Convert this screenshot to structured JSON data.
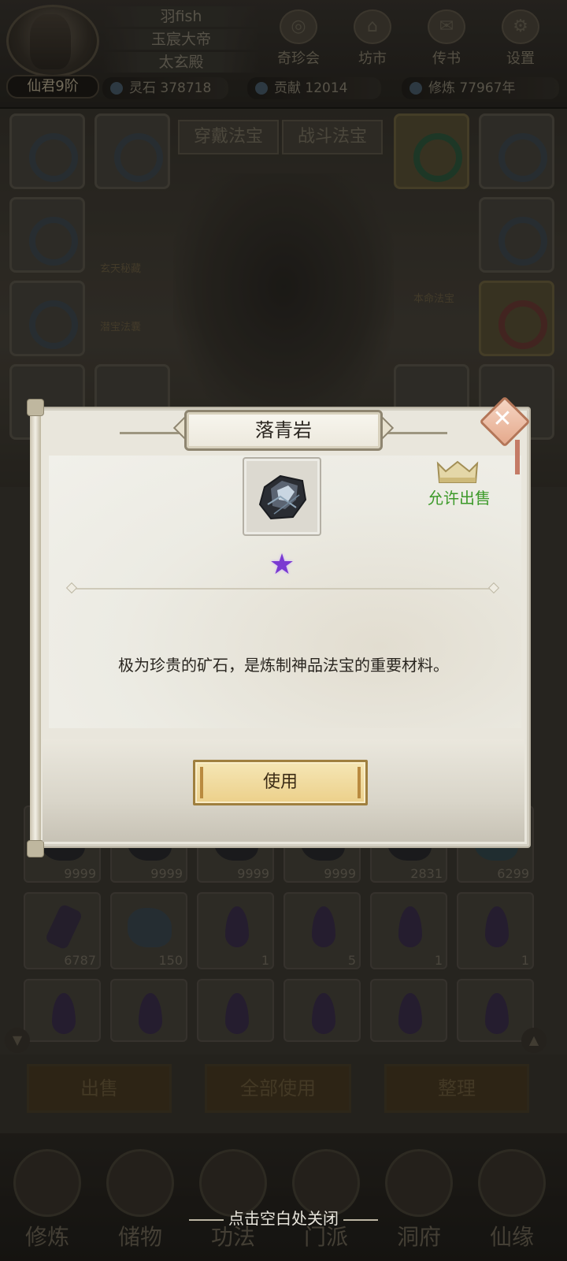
{
  "player": {
    "name": "羽fish",
    "title": "玉宸大帝",
    "sect": "太玄殿",
    "rank": "仙君9阶"
  },
  "resources": [
    {
      "label": "灵石 378718"
    },
    {
      "label": "贡献 12014"
    },
    {
      "label": "修炼 77967年"
    }
  ],
  "top_menu": [
    {
      "label": "奇珍会",
      "icon": "treasure-icon"
    },
    {
      "label": "坊市",
      "icon": "market-icon"
    },
    {
      "label": "传书",
      "icon": "letter-icon"
    },
    {
      "label": "设置",
      "icon": "gear-icon"
    }
  ],
  "equip_tabs": [
    "穿戴法宝",
    "战斗法宝"
  ],
  "equip_side_labels": [
    "玄天秘藏",
    "潜宝法囊",
    "本命法宝"
  ],
  "inventory_counts": {
    "row_a": [
      "9999",
      "9999",
      "9999",
      "9999",
      "2831",
      "6299"
    ],
    "row_b": [
      "6787",
      "150",
      "1",
      "5",
      "1",
      "1"
    ]
  },
  "bottom_buttons": [
    "出售",
    "全部使用",
    "整理"
  ],
  "nav": [
    "修炼",
    "储物",
    "功法",
    "门派",
    "洞府",
    "仙缘"
  ],
  "modal": {
    "title": "落青岩",
    "sell_status": "允许出售",
    "stars": "★",
    "description": "极为珍贵的矿石，是炼制神品法宝的重要材料。",
    "use_button": "使用",
    "close_icon": "close-icon",
    "item_icon": "ore-icon"
  },
  "close_hint": "点击空白处关闭",
  "colors": {
    "star": "#7a3ad1",
    "sell_status": "#3d9a2a",
    "use_button": "#ecd08a"
  }
}
